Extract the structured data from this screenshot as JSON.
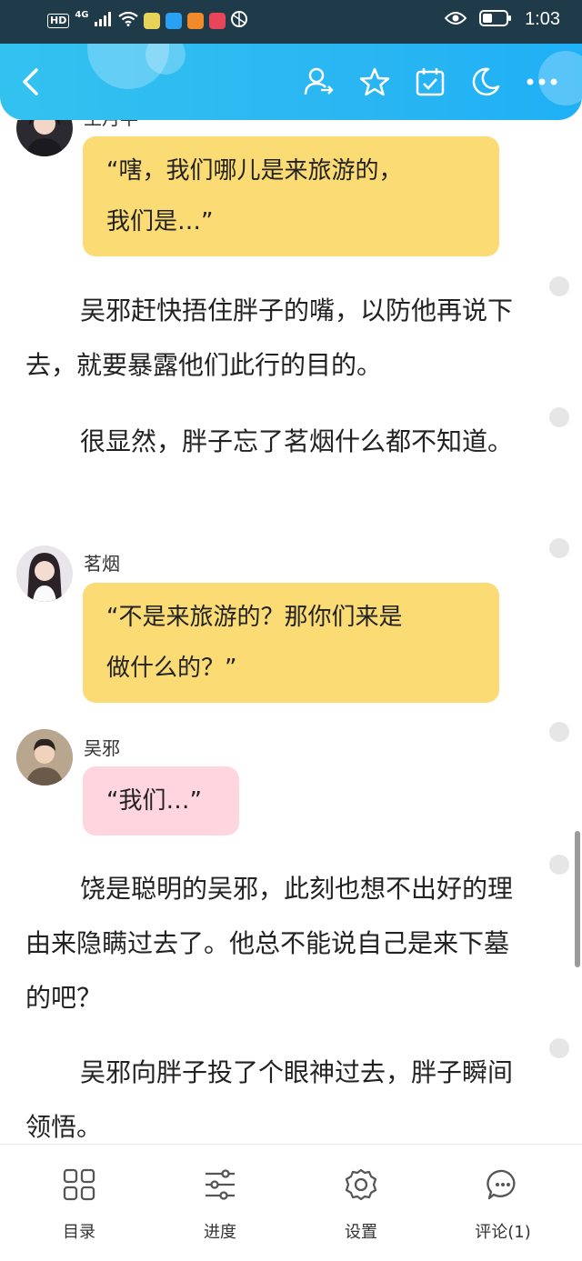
{
  "status_bar": {
    "hd": "HD",
    "network": "4G",
    "time": "1:03"
  },
  "app_bar": {
    "icons": [
      "back-icon",
      "user-switch-icon",
      "star-icon",
      "calendar-check-icon",
      "moon-icon",
      "more-icon"
    ]
  },
  "chat": [
    {
      "speaker": "王月半",
      "text_lines": [
        "“嗐，我们哪儿是来旅游的，",
        "我们是…”"
      ]
    },
    {
      "speaker": "茗烟",
      "text_lines": [
        "“不是来旅游的？那你们来是",
        "做什么的？”"
      ]
    },
    {
      "speaker": "吴邪",
      "text_lines": [
        "“我们…”"
      ]
    }
  ],
  "paragraphs": [
    "吴邪赶快捂住胖子的嘴，以防他再说下去，就要暴露他们此行的目的。",
    "很显然，胖子忘了茗烟什么都不知道。",
    "饶是聪明的吴邪，此刻也想不出好的理由来隐瞒过去了。他总不能说自己是来下墓的吧？",
    "吴邪向胖子投了个眼神过去，胖子瞬间领悟。"
  ],
  "bottom_nav": {
    "items": [
      {
        "label": "目录",
        "icon": "catalog-icon"
      },
      {
        "label": "进度",
        "icon": "progress-sliders-icon"
      },
      {
        "label": "设置",
        "icon": "settings-gear-icon"
      },
      {
        "label": "评论(1)",
        "icon": "comment-icon"
      }
    ]
  },
  "colors": {
    "app_bar": "#2ab6f2",
    "bubble_yellow": "#fbdb74",
    "bubble_pink": "#ffd6e0",
    "status_bar": "#1f3a48"
  }
}
